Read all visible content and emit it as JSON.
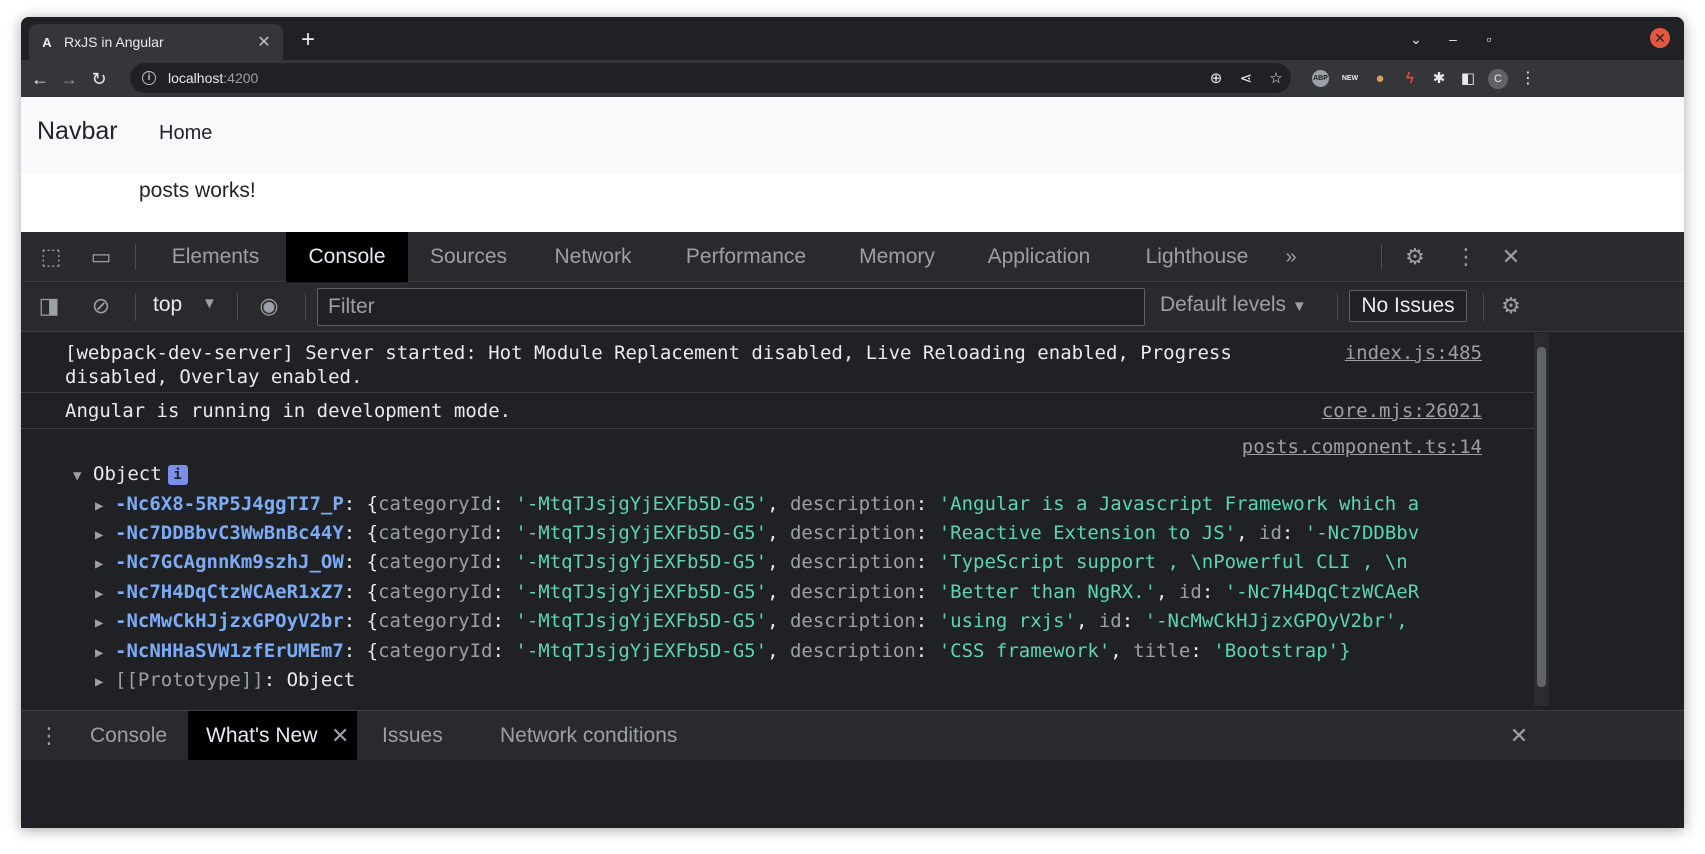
{
  "browser": {
    "tab_title": "RxJS in Angular",
    "tab_favicon": "A",
    "url_host": "localhost",
    "url_port": ":4200"
  },
  "page": {
    "brand": "Navbar",
    "home_link": "Home",
    "content": "posts works!"
  },
  "devtools": {
    "tabs": [
      "Elements",
      "Console",
      "Sources",
      "Network",
      "Performance",
      "Memory",
      "Application",
      "Lighthouse"
    ],
    "active_tab": "Console",
    "context": "top",
    "filter_placeholder": "Filter",
    "levels": "Default levels",
    "issues": "No Issues",
    "messages": [
      {
        "text_line1": "[webpack-dev-server] Server started: Hot Module Replacement disabled, Live Reloading enabled, Progress",
        "text_line2": "disabled, Overlay enabled.",
        "source": "index.js:485"
      },
      {
        "text_line1": "Angular is running in development mode.",
        "source": "core.mjs:26021"
      },
      {
        "source": "posts.component.ts:14",
        "object_label": "Object",
        "info_badge": "i",
        "entries": [
          {
            "key": "-Nc6X8-5RP5J4ggTI7_P",
            "categoryId": "'-MtqTJsjgYjEXFb5D-G5'",
            "second_prop": "description",
            "second_val": "'Angular is a Javascript Framework which a"
          },
          {
            "key": "-Nc7DDBbvC3WwBnBc44Y",
            "categoryId": "'-MtqTJsjgYjEXFb5D-G5'",
            "second_prop": "description",
            "second_val": "'Reactive Extension to JS'",
            "third_prop": "id",
            "third_val": "'-Nc7DDBbv"
          },
          {
            "key": "-Nc7GCAgnnKm9szhJ_OW",
            "categoryId": "'-MtqTJsjgYjEXFb5D-G5'",
            "second_prop": "description",
            "second_val": "'TypeScript support , \\nPowerful CLI , \\n"
          },
          {
            "key": "-Nc7H4DqCtzWCAeR1xZ7",
            "categoryId": "'-MtqTJsjgYjEXFb5D-G5'",
            "second_prop": "description",
            "second_val": "'Better than NgRX.'",
            "third_prop": "id",
            "third_val": "'-Nc7H4DqCtzWCAeR"
          },
          {
            "key": "-NcMwCkHJjzxGPOyV2br",
            "categoryId": "'-MtqTJsjgYjEXFb5D-G5'",
            "second_prop": "description",
            "second_val": "'using rxjs'",
            "third_prop": "id",
            "third_val": "'-NcMwCkHJjzxGPOyV2br',"
          },
          {
            "key": "-NcNHHaSVW1zfErUMEm7",
            "categoryId": "'-MtqTJsjgYjEXFb5D-G5'",
            "second_prop": "description",
            "second_val": "'CSS framework'",
            "third_prop": "title",
            "third_val": "'Bootstrap'}"
          }
        ],
        "prototype_label": "[[Prototype]]",
        "prototype_value": "Object"
      }
    ],
    "drawer_tabs": [
      "Console",
      "What's New",
      "Issues",
      "Network conditions"
    ],
    "drawer_active": "What's New"
  },
  "colors": {
    "devtools_bg": "#202124",
    "key_blue": "#7cacf8",
    "string_teal": "#5cd5b3",
    "close_red": "#e2583e"
  }
}
